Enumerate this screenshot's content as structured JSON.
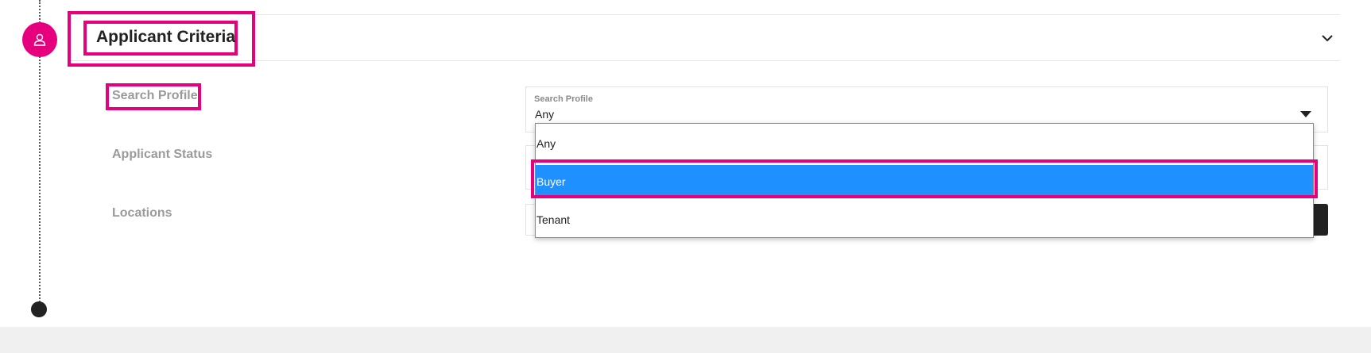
{
  "section": {
    "title": "Applicant Criteria",
    "icon": "user-icon",
    "toggle_icon": "chevron-down-icon"
  },
  "rows": [
    {
      "label": "Search Profile"
    },
    {
      "label": "Applicant Status"
    },
    {
      "label": "Locations"
    }
  ],
  "search_profile_field": {
    "label": "Search Profile",
    "value": "Any"
  },
  "dropdown": {
    "options": [
      "Any",
      "Buyer",
      "Tenant"
    ],
    "highlighted": "Buyer"
  },
  "colors": {
    "accent": "#e6007e",
    "selected_option": "#1e90ff",
    "label_gray": "#9a9a9a"
  }
}
